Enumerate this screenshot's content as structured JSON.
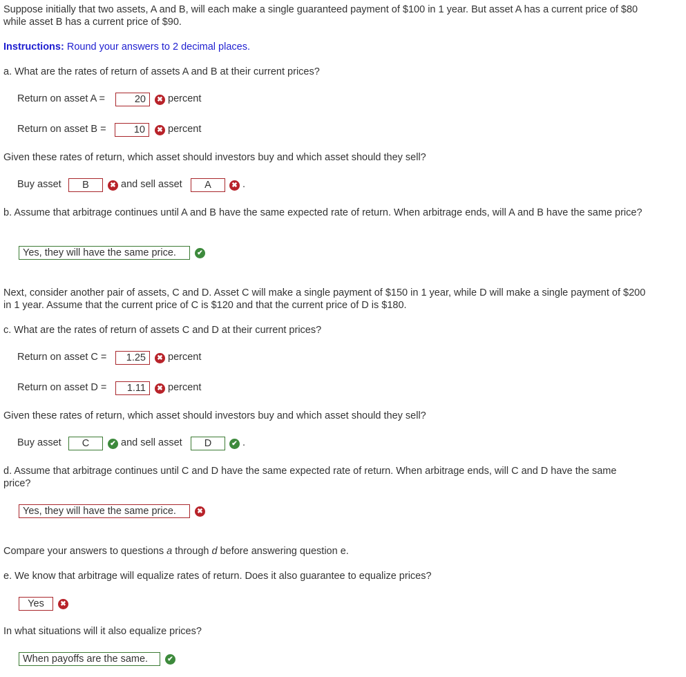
{
  "intro": "Suppose initially that two assets, A and B, will each make a single guaranteed payment of $100 in 1 year. But asset A has a current price of $80 while asset B has a current price of $90.",
  "instructions": {
    "label": "Instructions:",
    "text": " Round your answers to 2 decimal places."
  },
  "qa": "a. What are the rates of return of assets A and B at their current prices?",
  "retA": {
    "label": "Return on asset A =",
    "value": "20",
    "status": "incorrect",
    "unit": "percent"
  },
  "retB": {
    "label": "Return on asset B =",
    "value": "10",
    "status": "incorrect",
    "unit": "percent"
  },
  "given1": "Given these rates of return, which asset should investors buy and which asset should they sell?",
  "trade1": {
    "buy_label": "Buy asset",
    "buy_value": "B",
    "buy_status": "incorrect",
    "sell_label": "and sell asset",
    "sell_value": "A",
    "sell_status": "incorrect",
    "end": "."
  },
  "qb": "b. Assume that arbitrage continues until A and B have the same expected rate of return. When arbitrage ends, will A and B have the same price?",
  "ansB": {
    "value": "Yes, they will have the same price.",
    "status": "correct"
  },
  "next": "Next, consider another pair of assets, C and D. Asset C will make a single payment of $150 in 1 year, while D will make a single payment of $200 in 1 year. Assume that the current price of C is $120 and that the current price of D is $180.",
  "qc": "c. What are the rates of return of assets C and D at their current prices?",
  "retC": {
    "label": "Return on asset C =",
    "value": "1.25",
    "status": "incorrect",
    "unit": "percent"
  },
  "retD": {
    "label": "Return on asset D =",
    "value": "1.11",
    "status": "incorrect",
    "unit": "percent"
  },
  "given2": "Given these rates of return, which asset should investors buy and which asset should they sell?",
  "trade2": {
    "buy_label": "Buy asset",
    "buy_value": "C",
    "buy_status": "correct",
    "sell_label": "and sell asset",
    "sell_value": "D",
    "sell_status": "correct",
    "end": "."
  },
  "qd": "d. Assume that arbitrage continues until C and D have the same expected rate of return. When arbitrage ends, will C and D have the same price?",
  "ansD": {
    "value": "Yes, they will have the same price.",
    "status": "incorrect"
  },
  "compare": {
    "pre": "Compare your answers to questions ",
    "a": "a",
    "mid": " through ",
    "d": "d",
    "post": " before answering question e."
  },
  "qe": "e. We know that arbitrage will equalize rates of return. Does it also guarantee to equalize prices?",
  "ansE": {
    "value": "Yes",
    "status": "incorrect"
  },
  "qf": "In what situations will it also equalize prices?",
  "ansF": {
    "value": "When payoffs are the same.",
    "status": "correct"
  },
  "icons": {
    "incorrect": "✖",
    "correct": "✔"
  }
}
